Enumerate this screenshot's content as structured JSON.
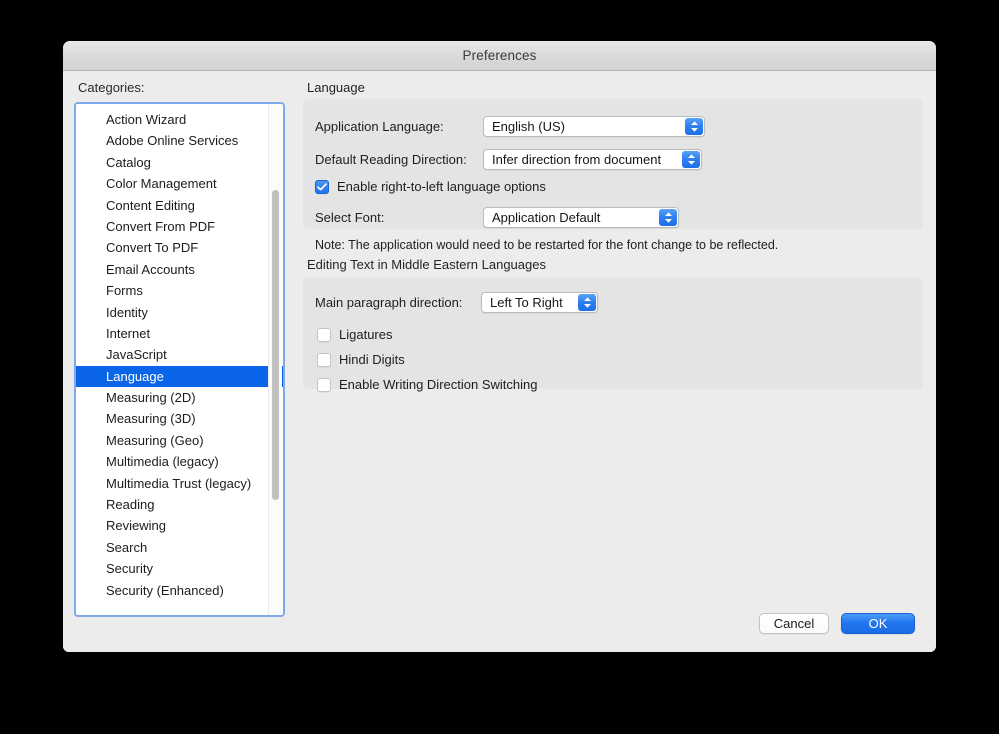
{
  "window": {
    "title": "Preferences"
  },
  "sidebar": {
    "label": "Categories:",
    "selected": "Language",
    "items": [
      {
        "label": "Action Wizard"
      },
      {
        "label": "Adobe Online Services"
      },
      {
        "label": "Catalog"
      },
      {
        "label": "Color Management"
      },
      {
        "label": "Content Editing"
      },
      {
        "label": "Convert From PDF"
      },
      {
        "label": "Convert To PDF"
      },
      {
        "label": "Email Accounts"
      },
      {
        "label": "Forms"
      },
      {
        "label": "Identity"
      },
      {
        "label": "Internet"
      },
      {
        "label": "JavaScript"
      },
      {
        "label": "Language"
      },
      {
        "label": "Measuring (2D)"
      },
      {
        "label": "Measuring (3D)"
      },
      {
        "label": "Measuring (Geo)"
      },
      {
        "label": "Multimedia (legacy)"
      },
      {
        "label": "Multimedia Trust (legacy)"
      },
      {
        "label": "Reading"
      },
      {
        "label": "Reviewing"
      },
      {
        "label": "Search"
      },
      {
        "label": "Security"
      },
      {
        "label": "Security (Enhanced)"
      }
    ]
  },
  "language_section": {
    "title": "Language",
    "application_language": {
      "label": "Application Language:",
      "value": "English (US)"
    },
    "default_reading_direction": {
      "label": "Default Reading Direction:",
      "value": "Infer direction from document"
    },
    "enable_rtl": {
      "label": "Enable right-to-left language options",
      "checked": true
    },
    "select_font": {
      "label": "Select Font:",
      "value": "Application Default"
    },
    "note": "Note: The application would need to be restarted for the font change to be reflected."
  },
  "editing_section": {
    "title": "Editing Text in Middle Eastern Languages",
    "main_paragraph_direction": {
      "label": "Main paragraph direction:",
      "value": "Left To Right"
    },
    "ligatures": {
      "label": "Ligatures",
      "checked": false
    },
    "hindi_digits": {
      "label": "Hindi Digits",
      "checked": false
    },
    "writing_direction_switching": {
      "label": "Enable Writing Direction Switching",
      "checked": false
    }
  },
  "footer": {
    "cancel_label": "Cancel",
    "ok_label": "OK"
  },
  "colors": {
    "accent": "#0a65e8",
    "selection": "#0a65e8",
    "window_bg": "#ececec",
    "panel_bg": "#e4e4e4",
    "focus_ring": "#7fa9e8"
  }
}
